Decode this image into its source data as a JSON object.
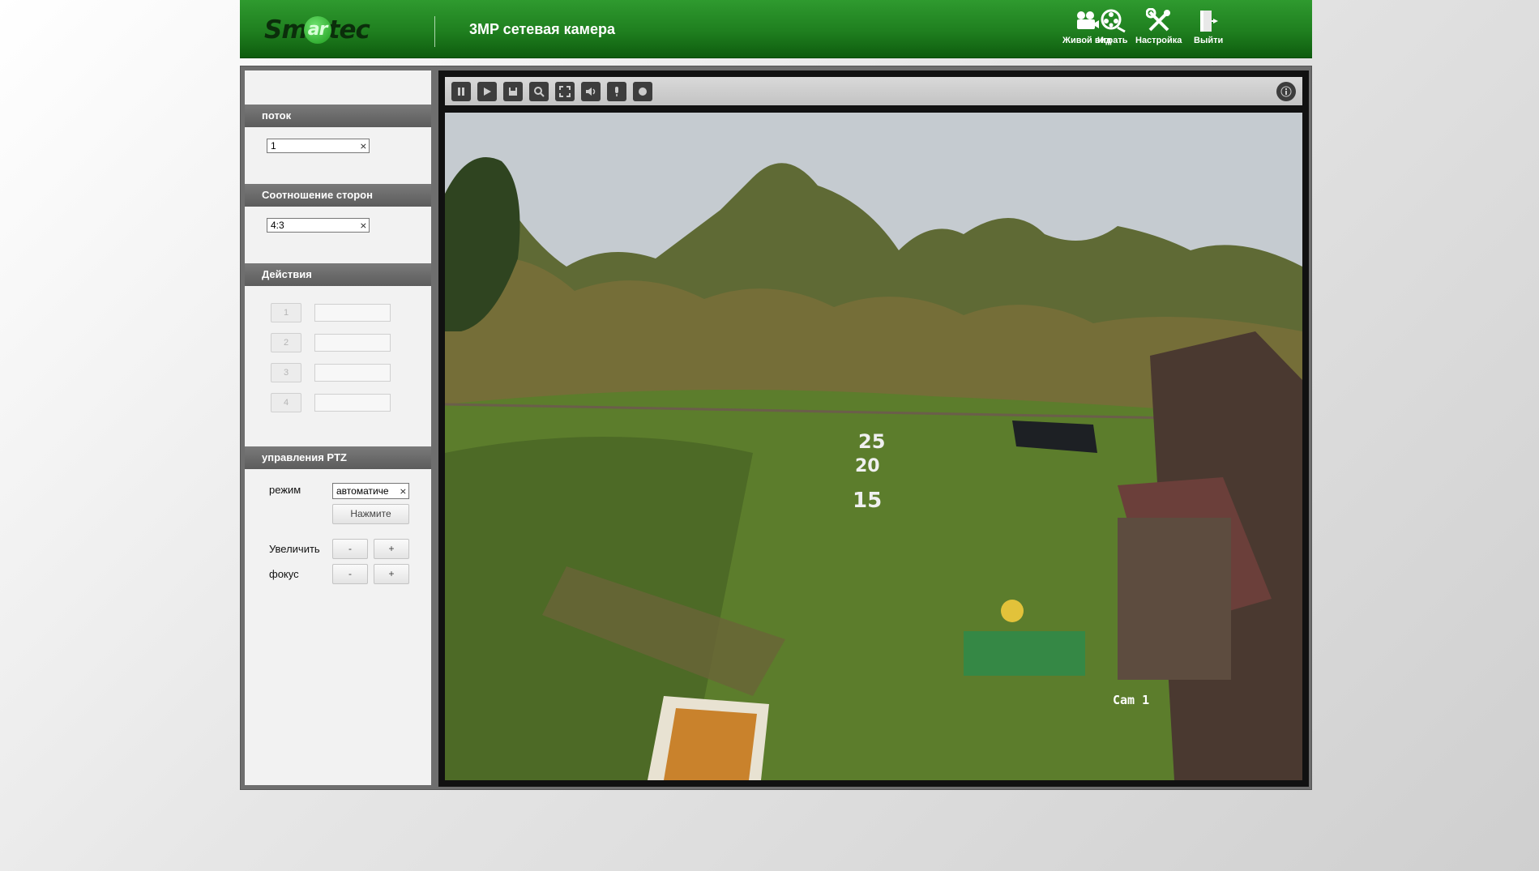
{
  "header": {
    "logo_text": "Smartec",
    "title": "3MP сетевая камера",
    "nav": [
      {
        "label": "Живой вид",
        "icon": "video-camera-icon"
      },
      {
        "label": "Играть",
        "icon": "film-reel-icon"
      },
      {
        "label": "Настройка",
        "icon": "tools-icon"
      },
      {
        "label": "Выйти",
        "icon": "exit-door-icon"
      }
    ]
  },
  "sidebar": {
    "stream": {
      "title": "поток",
      "value": "1"
    },
    "aspect": {
      "title": "Соотношение сторон",
      "value": "4:3"
    },
    "actions": {
      "title": "Действия",
      "items": [
        "1",
        "2",
        "3",
        "4"
      ]
    },
    "ptz": {
      "title": "управления PTZ",
      "mode_label": "режим",
      "mode_value": "автоматиче",
      "press_label": "Нажмите",
      "zoom_label": "Увеличить",
      "focus_label": "фокус",
      "minus": "-",
      "plus": "+"
    }
  },
  "toolbar": {
    "buttons": [
      "pause-icon",
      "play-icon",
      "save-icon",
      "zoom-icon",
      "fullscreen-icon",
      "audio-icon",
      "microphone-icon",
      "record-icon"
    ],
    "info_icon": "info-icon"
  },
  "video": {
    "osd_camera": "Cam 1",
    "field_numbers": [
      "25",
      "20",
      "15"
    ]
  },
  "colors": {
    "header_green": "#1f7f1f",
    "section_header": "#666666",
    "frame": "#6e6e6e"
  }
}
